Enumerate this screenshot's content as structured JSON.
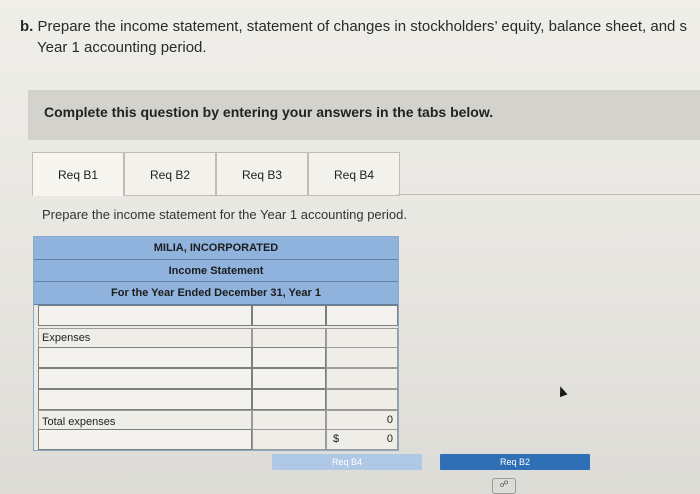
{
  "question": {
    "label": "b.",
    "line1": " Prepare the income statement, statement of changes in stockholders’ equity, balance sheet, and s",
    "line2": "Year 1 accounting period."
  },
  "banner": {
    "text": "Complete this question by entering your answers in the tabs below."
  },
  "tabs": [
    {
      "label": "Req B1",
      "active": true
    },
    {
      "label": "Req B2",
      "active": false
    },
    {
      "label": "Req B3",
      "active": false
    },
    {
      "label": "Req B4",
      "active": false
    }
  ],
  "instruction": "Prepare the income statement for the Year 1 accounting period.",
  "statement": {
    "company": "MILIA, INCORPORATED",
    "title": "Income Statement",
    "period": "For the Year Ended December 31, Year 1",
    "expenses_label": "Expenses",
    "total_expenses_label": "Total expenses",
    "total_expenses_value": "0",
    "net_currency": "$",
    "net_value": "0"
  },
  "nav": {
    "prev_label": "Req B4",
    "next_label": "Req B2"
  },
  "colors": {
    "header_blue": "#8fb3dd",
    "next_button": "#2f6fb6"
  }
}
